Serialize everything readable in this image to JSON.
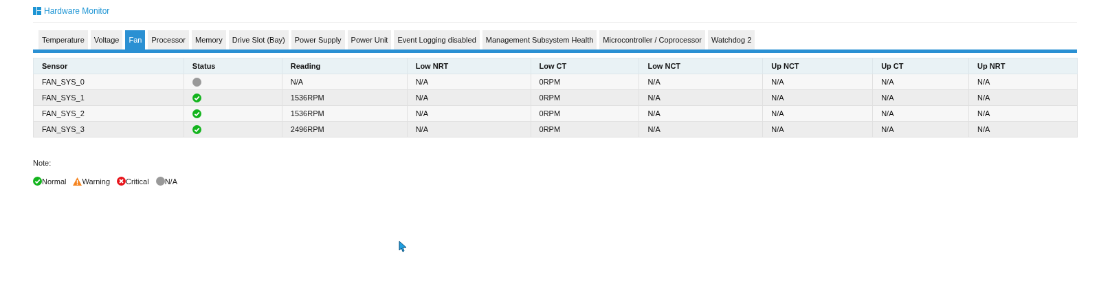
{
  "header": {
    "title": "Hardware Monitor"
  },
  "tabs": [
    {
      "label": "Temperature",
      "selected": false
    },
    {
      "label": "Voltage",
      "selected": false
    },
    {
      "label": "Fan",
      "selected": true
    },
    {
      "label": "Processor",
      "selected": false
    },
    {
      "label": "Memory",
      "selected": false
    },
    {
      "label": "Drive Slot (Bay)",
      "selected": false
    },
    {
      "label": "Power Supply",
      "selected": false
    },
    {
      "label": "Power Unit",
      "selected": false
    },
    {
      "label": "Event Logging disabled",
      "selected": false
    },
    {
      "label": "Management Subsystem Health",
      "selected": false
    },
    {
      "label": "Microcontroller / Coprocessor",
      "selected": false
    },
    {
      "label": "Watchdog 2",
      "selected": false
    }
  ],
  "table": {
    "columns": [
      "Sensor",
      "Status",
      "Reading",
      "Low NRT",
      "Low CT",
      "Low NCT",
      "Up NCT",
      "Up CT",
      "Up NRT"
    ],
    "rows": [
      {
        "cells": [
          "FAN_SYS_0",
          {
            "kind": "na"
          },
          "N/A",
          "N/A",
          "0RPM",
          "N/A",
          "N/A",
          "N/A",
          "N/A"
        ]
      },
      {
        "cells": [
          "FAN_SYS_1",
          {
            "kind": "normal"
          },
          "1536RPM",
          "N/A",
          "0RPM",
          "N/A",
          "N/A",
          "N/A",
          "N/A"
        ]
      },
      {
        "cells": [
          "FAN_SYS_2",
          {
            "kind": "normal"
          },
          "1536RPM",
          "N/A",
          "0RPM",
          "N/A",
          "N/A",
          "N/A",
          "N/A"
        ]
      },
      {
        "cells": [
          "FAN_SYS_3",
          {
            "kind": "normal"
          },
          "2496RPM",
          "N/A",
          "0RPM",
          "N/A",
          "N/A",
          "N/A",
          "N/A"
        ]
      }
    ]
  },
  "legend": {
    "title": "Note:",
    "items": [
      {
        "kind": "normal",
        "label": "Normal"
      },
      {
        "kind": "warning",
        "label": "Warning"
      },
      {
        "kind": "critical",
        "label": "Critical"
      },
      {
        "kind": "na",
        "label": "N/A"
      }
    ]
  }
}
